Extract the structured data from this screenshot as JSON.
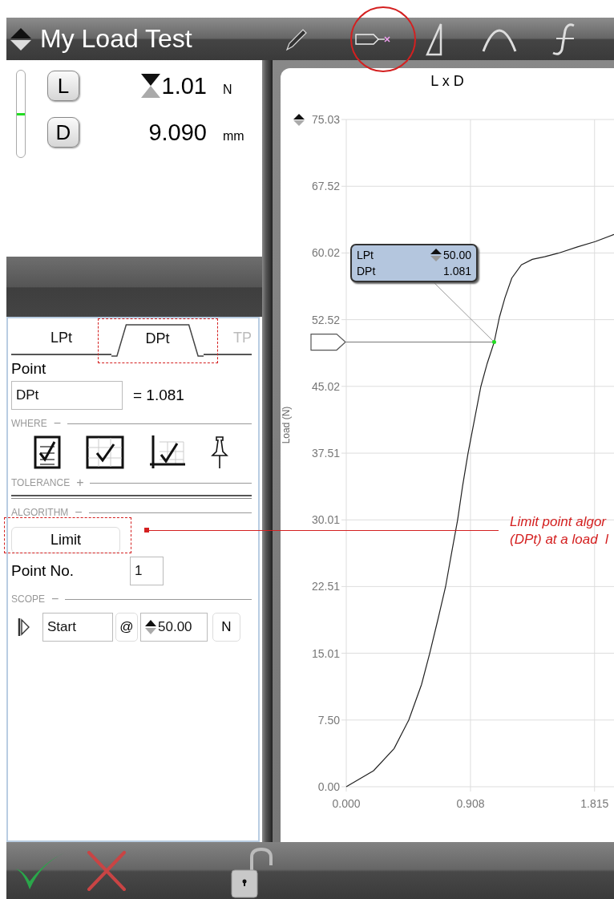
{
  "header": {
    "title": "My Load Test"
  },
  "readings": {
    "level": 0.5,
    "items": [
      {
        "button": "L",
        "value": "1.01",
        "unit": "N",
        "kind": "peak"
      },
      {
        "button": "D",
        "value": "9.090",
        "unit": "mm",
        "kind": "plain"
      }
    ]
  },
  "tabs": [
    {
      "label": "LPt",
      "selected": false,
      "disabled": false
    },
    {
      "label": "DPt",
      "selected": true,
      "disabled": false
    },
    {
      "label": "TP",
      "selected": false,
      "disabled": true
    }
  ],
  "point": {
    "label": "Point",
    "value": "DPt",
    "result": "= 1.081"
  },
  "where": {
    "title": "WHERE",
    "toggle": "−"
  },
  "tolerance": {
    "title": "TOLERANCE",
    "toggle": "+"
  },
  "algorithm": {
    "title": "ALGORITHM",
    "toggle": "−",
    "button": "Limit"
  },
  "point_no": {
    "label": "Point No.",
    "value": "1"
  },
  "scope": {
    "title": "SCOPE",
    "toggle": "−",
    "start": "Start",
    "at": "@",
    "value": "50.00",
    "unit": "N"
  },
  "chart": {
    "tooltip": [
      {
        "label": "LPt",
        "value": "50.00",
        "kind": "spin"
      },
      {
        "label": "DPt",
        "value": "1.081",
        "kind": "plain"
      }
    ],
    "chart_data": {
      "type": "line",
      "title": "L x D",
      "ylabel": "Load (N)",
      "x": [
        0,
        0.2,
        0.35,
        0.457,
        0.55,
        0.61,
        0.67,
        0.726,
        0.77,
        0.814,
        0.85,
        0.89,
        0.94,
        0.984,
        1.03,
        1.081,
        1.12,
        1.16,
        1.21,
        1.28,
        1.36,
        1.45,
        1.55,
        1.69,
        1.82,
        1.957
      ],
      "series": [
        {
          "color": "#222222",
          "values": [
            0,
            1.8,
            4.3,
            7.5,
            11.5,
            15.0,
            18.8,
            22.5,
            26.3,
            30.0,
            33.8,
            37.5,
            41.5,
            45.0,
            47.6,
            50.0,
            52.8,
            55.0,
            57.2,
            58.7,
            59.3,
            59.6,
            60.0,
            60.7,
            61.3,
            62.1
          ]
        }
      ],
      "grid": true,
      "ref_lines": [
        {
          "axis": "y",
          "value": 50
        }
      ],
      "xlim": [
        0,
        1.957
      ],
      "ylim": [
        0,
        75.03
      ],
      "xticks": [
        {
          "value": 0,
          "label": "0.000"
        },
        {
          "value": 0.908,
          "label": "0.908"
        },
        {
          "value": 1.815,
          "label": "1.815"
        }
      ],
      "yticks": [
        {
          "value": 0,
          "label": "0.00"
        },
        {
          "value": 7.5,
          "label": "7.50"
        },
        {
          "value": 15.01,
          "label": "15.01"
        },
        {
          "value": 22.51,
          "label": "22.51"
        },
        {
          "value": 30.01,
          "label": "30.01"
        },
        {
          "value": 37.51,
          "label": "37.51"
        },
        {
          "value": 45.02,
          "label": "45.02"
        },
        {
          "value": 52.52,
          "label": "52.52"
        },
        {
          "value": 60.02,
          "label": "60.02"
        },
        {
          "value": 67.52,
          "label": "67.52"
        },
        {
          "value": 75.03,
          "label": "75.03"
        }
      ]
    }
  },
  "annotation": {
    "lines": [
      "Limit point algor",
      "(DPt) at a load  l"
    ]
  }
}
